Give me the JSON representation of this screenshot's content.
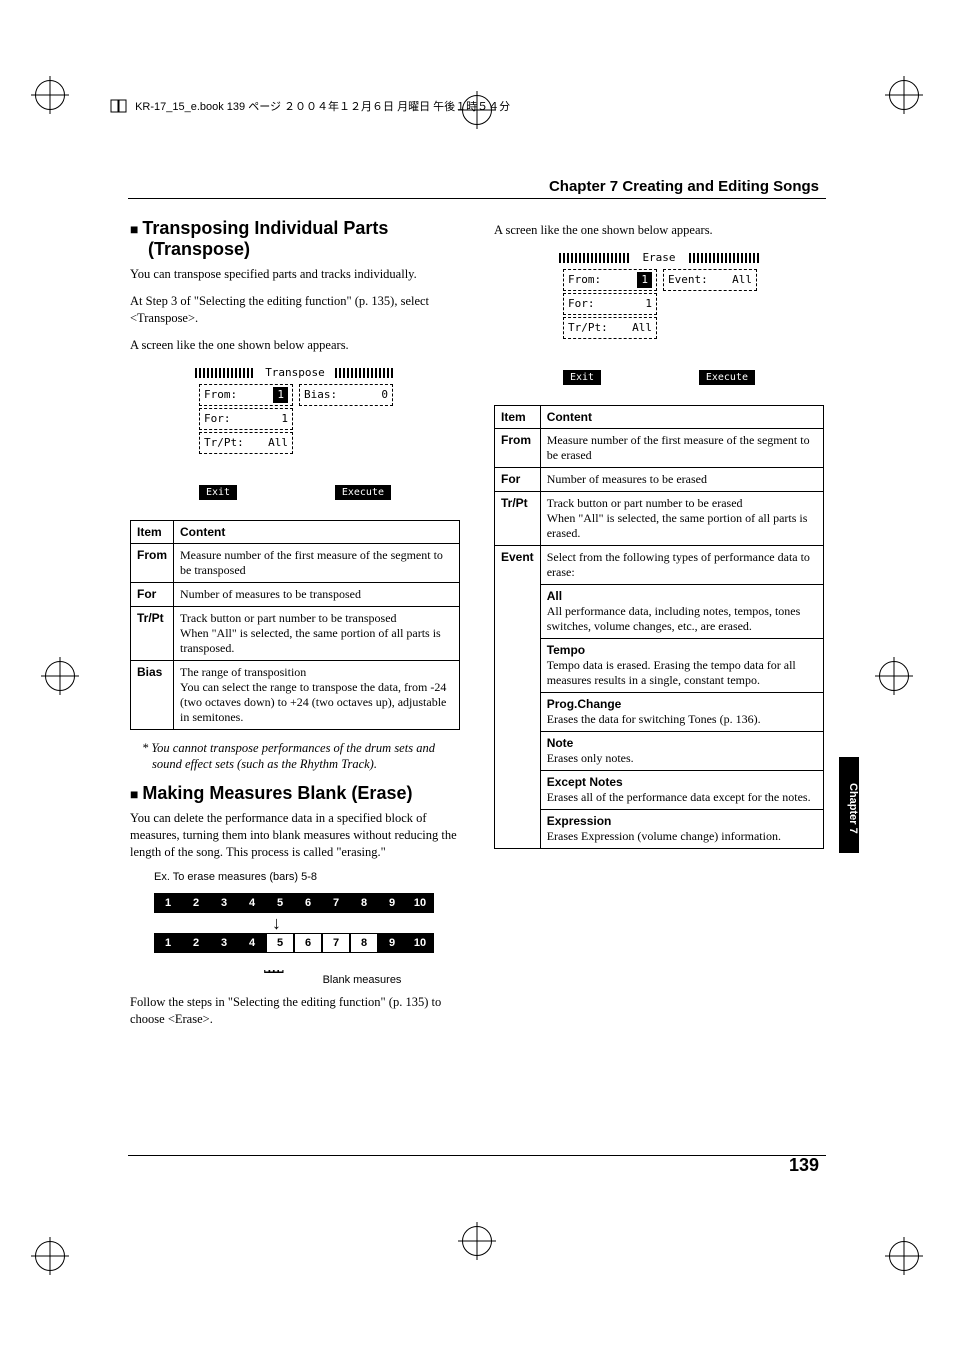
{
  "book_line": "KR-17_15_e.book 139 ページ ２００４年１２月６日 月曜日 午後１時５４分",
  "chapter_header": "Chapter 7 Creating and Editing Songs",
  "side_tab": "Chapter 7",
  "page_number": "139",
  "col1": {
    "h_transpose": "Transposing Individual Parts (Transpose)",
    "p_trans_intro": "You can transpose specified parts and tracks individually.",
    "p_trans_step3": "At Step 3 of \"Selecting the editing function\" (p. 135), select <Transpose>.",
    "p_screen_appears": "A screen like the one shown below appears.",
    "scr_transpose": {
      "title": "Transpose",
      "from_lbl": "From:",
      "from_val": "1",
      "for_lbl": "For:",
      "for_val": "1",
      "trpt_lbl": "Tr/Pt:",
      "trpt_val": "All",
      "bias_lbl": "Bias:",
      "bias_val": "0",
      "exit": "Exit",
      "execute": "Execute"
    },
    "table_trans": {
      "h_item": "Item",
      "h_content": "Content",
      "from_lbl": "From",
      "from_txt": "Measure number of the first measure of the segment to be transposed",
      "for_lbl": "For",
      "for_txt": "Number of measures to be transposed",
      "trpt_lbl": "Tr/Pt",
      "trpt_txt1": "Track button or part number to be transposed",
      "trpt_txt2": "When \"All\" is selected, the same portion of all parts is transposed.",
      "bias_lbl": "Bias",
      "bias_txt1": "The range of transposition",
      "bias_txt2": "You can select the range to transpose the data, from -24 (two octaves down) to +24 (two octaves up), adjustable in semitones."
    },
    "note_drum": "*   You cannot transpose performances of the drum sets and sound effect sets (such as the Rhythm Track).",
    "h_erase": "Making Measures Blank (Erase)",
    "p_erase_intro": "You can delete the performance data in a specified block of measures, turning them into blank measures without reducing the length of the song. This process is called \"erasing.\"",
    "fig_caption": "Ex. To erase measures (bars) 5-8",
    "fig_blank": "Blank measures",
    "p_erase_follow": "Follow the steps in \"Selecting the editing function\" (p. 135) to choose <Erase>."
  },
  "col2": {
    "p_screen_appears": "A screen like the one shown below appears.",
    "scr_erase": {
      "title": "Erase",
      "from_lbl": "From:",
      "from_val": "1",
      "for_lbl": "For:",
      "for_val": "1",
      "trpt_lbl": "Tr/Pt:",
      "trpt_val": "All",
      "event_lbl": "Event:",
      "event_val": "All",
      "exit": "Exit",
      "execute": "Execute"
    },
    "table_erase": {
      "h_item": "Item",
      "h_content": "Content",
      "from_lbl": "From",
      "from_txt": "Measure number of the first measure of the segment to be erased",
      "for_lbl": "For",
      "for_txt": "Number of measures to be erased",
      "trpt_lbl": "Tr/Pt",
      "trpt_txt1": "Track button or part number to be erased",
      "trpt_txt2": "When \"All\" is selected, the same portion of all parts is erased.",
      "event_lbl": "Event",
      "event_intro": "Select from the following types of performance data to erase:",
      "ev_all_h": "All",
      "ev_all_t": "All performance data, including notes, tempos, tones switches, volume changes, etc., are erased.",
      "ev_tempo_h": "Tempo",
      "ev_tempo_t": "Tempo data is erased. Erasing the tempo data for all measures results in a single, constant tempo.",
      "ev_prog_h": "Prog.Change",
      "ev_prog_t": "Erases the data for switching Tones (p. 136).",
      "ev_note_h": "Note",
      "ev_note_t": "Erases only notes.",
      "ev_exn_h": "Except Notes",
      "ev_exn_t": "Erases all of the performance data except for the notes.",
      "ev_expr_h": "Expression",
      "ev_expr_t": "Erases Expression (volume change) information."
    }
  }
}
